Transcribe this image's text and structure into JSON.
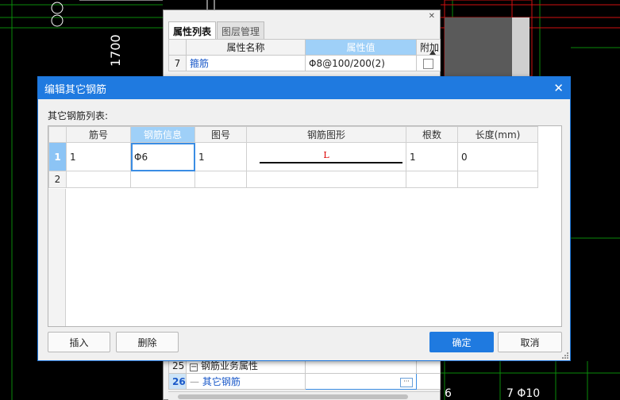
{
  "cad": {
    "dimension_text": "1700",
    "note_left": "6",
    "note_right": "7 Φ10"
  },
  "props_panel": {
    "tabs": [
      {
        "label": "属性列表",
        "active": true
      },
      {
        "label": "图层管理",
        "active": false
      }
    ],
    "headers": {
      "name": "属性名称",
      "value": "属性值",
      "extra": "附加"
    },
    "rows": [
      {
        "num": "7",
        "name": "箍筋",
        "value": "Φ8@100/200(2)"
      }
    ],
    "bottom_rows": [
      {
        "num": "25",
        "name": "钢筋业务属性"
      },
      {
        "num": "26",
        "name": "其它钢筋"
      }
    ]
  },
  "dialog": {
    "title": "编辑其它钢筋",
    "list_label": "其它钢筋列表:",
    "columns": [
      "筋号",
      "钢筋信息",
      "图号",
      "钢筋图形",
      "根数",
      "长度(mm)"
    ],
    "rows": [
      {
        "row_num": "1",
        "bar_no": "1",
        "info": "Φ6",
        "fig_no": "1",
        "shape_label": "L",
        "count": "1",
        "length": "0"
      },
      {
        "row_num": "2",
        "bar_no": "",
        "info": "",
        "fig_no": "",
        "shape_label": "",
        "count": "",
        "length": ""
      }
    ],
    "buttons": {
      "insert": "插入",
      "delete": "删除",
      "ok": "确定",
      "cancel": "取消"
    }
  },
  "colors": {
    "accent": "#1f7ae0",
    "header_selected": "#9fd0f8",
    "link": "#1a59c9"
  }
}
